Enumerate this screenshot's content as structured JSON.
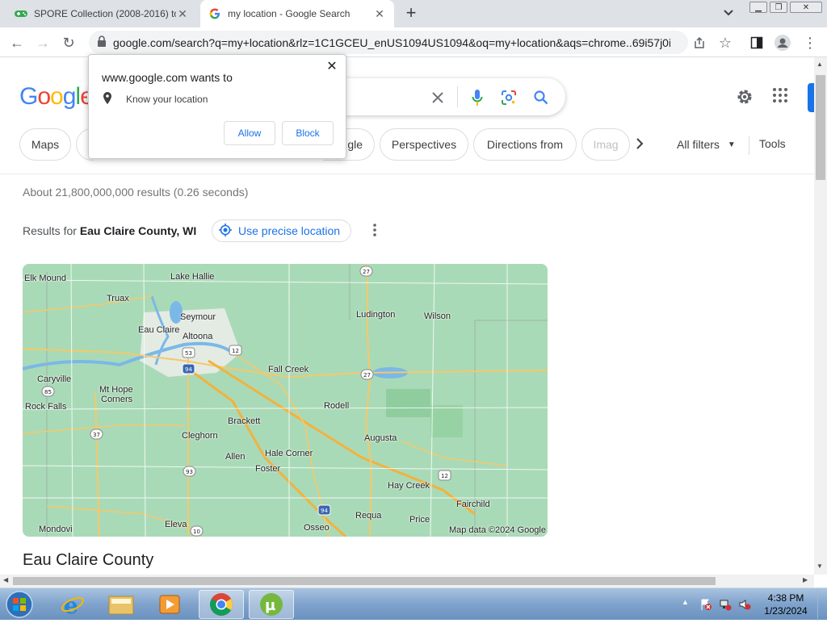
{
  "browser": {
    "tabs": [
      {
        "title": "SPORE Collection (2008-2016) to",
        "active": false,
        "favicon": "gamepad-icon"
      },
      {
        "title": "my location - Google Search",
        "active": true,
        "favicon": "google-g-icon"
      }
    ],
    "url": "google.com/search?q=my+location&rlz=1C1GCEU_enUS1094US1094&oq=my+location&aqs=chrome..69i57j0i..."
  },
  "popup": {
    "title": "www.google.com wants to",
    "permission": "Know your location",
    "allow_label": "Allow",
    "block_label": "Block"
  },
  "search": {
    "logo": "Google",
    "chips": [
      "Maps",
      "gle",
      "Perspectives",
      "Directions from",
      "Imag"
    ],
    "all_filters": "All filters",
    "tools": "Tools",
    "result_stats": "About 21,800,000,000 results (0.26 seconds)",
    "results_for_prefix": "Results for",
    "results_for_location": "Eau Claire County, WI",
    "use_precise_location": "Use precise location",
    "county_title": "Eau Claire County"
  },
  "map": {
    "credit": "Map data ©2024 Google",
    "places": [
      "Elk Mound",
      "Lake Hallie",
      "Truax",
      "Seymour",
      "Eau Claire",
      "Altoona",
      "Ludington",
      "Wilson",
      "Fall Creek",
      "Caryville",
      "Mt Hope",
      "Corners",
      "Rock Falls",
      "Rodell",
      "Brackett",
      "Cleghorn",
      "Augusta",
      "Hale Corner",
      "Allen",
      "Foster",
      "Hay Creek",
      "Fairchild",
      "Requa",
      "Price",
      "Mondovi",
      "Eleva",
      "Osseo"
    ],
    "route_shields": [
      "27",
      "53",
      "12",
      "94",
      "27",
      "85",
      "37",
      "93",
      "12",
      "94",
      "10"
    ]
  },
  "taskbar": {
    "time": "4:38 PM",
    "date": "1/23/2024"
  },
  "colors": {
    "google_blue": "#4285f4",
    "google_red": "#ea4335",
    "google_yellow": "#fbbc05",
    "google_green": "#34a853",
    "map_green": "#a8d8b5",
    "link_blue": "#1a73e8"
  }
}
